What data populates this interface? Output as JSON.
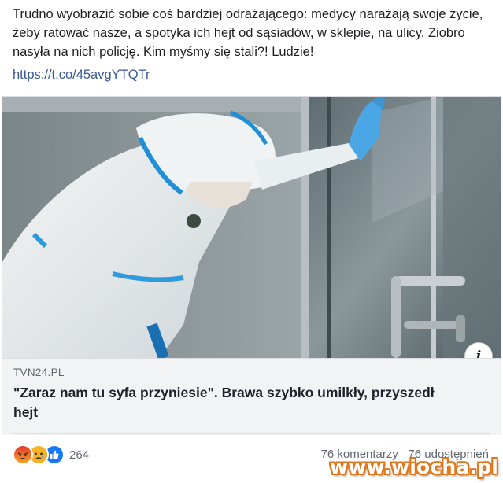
{
  "post": {
    "text": "Trudno wyobrazić sobie coś bardziej odrażającego: medycy narażają swoje życie, żeby ratować nasze, a spotyka ich hejt od sąsiadów, w sklepie, na ulicy. Ziobro nasyła na nich policję. Kim myśmy się stali?! Ludzie!",
    "link": "https://t.co/45avgYTQTr"
  },
  "link_card": {
    "domain": "TVN24.PL",
    "title": "\"Zaraz nam tu syfa przyniesie\". Brawa szybko umilkły, przyszedł hejt",
    "info_icon": "i",
    "image_description": "medical-worker-in-protective-suit"
  },
  "reactions": {
    "icons": [
      "angry-icon",
      "sad-icon",
      "like-icon"
    ],
    "count": "264"
  },
  "stats": {
    "comments": "76 komentarzy",
    "shares": "76 udostępnień"
  },
  "watermark": {
    "text": "www.wiocha.pl"
  },
  "colors": {
    "link": "#385898",
    "footer_bg": "#f2f3f5",
    "like": "#1877f2",
    "angry": "#e9710f",
    "sad": "#f7b125",
    "watermark_outline": "#e3761a"
  }
}
